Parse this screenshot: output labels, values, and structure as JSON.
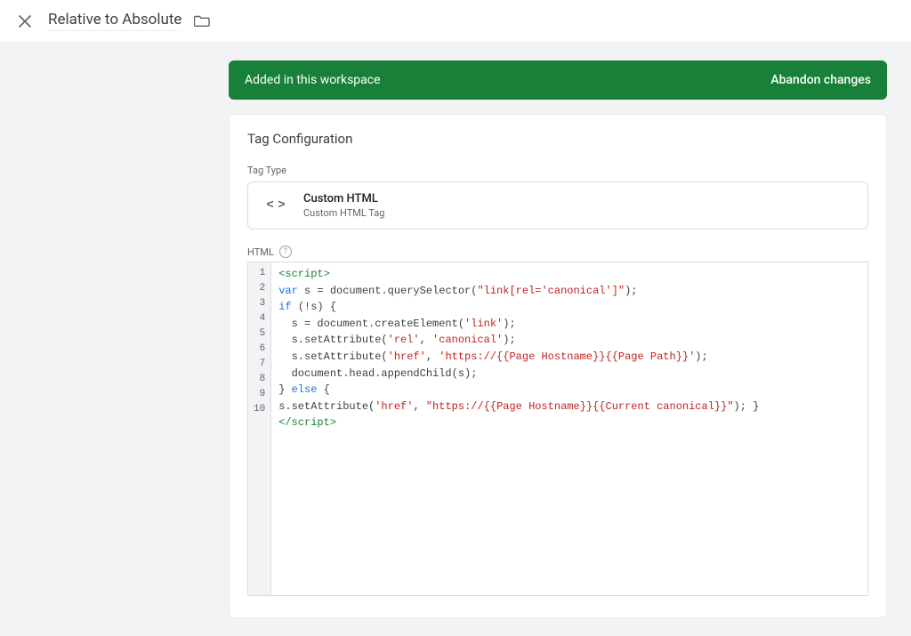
{
  "topbar": {
    "title": "Relative to Absolute"
  },
  "banner": {
    "message": "Added in this workspace",
    "action": "Abandon changes"
  },
  "card": {
    "title": "Tag Configuration",
    "tagtype_label": "Tag Type",
    "tagtype_name": "Custom HTML",
    "tagtype_sub": "Custom HTML Tag",
    "html_label": "HTML",
    "code_lines": [
      {
        "n": 1,
        "raw": "<script>",
        "tokens": [
          [
            "<script>",
            "tag"
          ]
        ]
      },
      {
        "n": 2,
        "raw": "var s = document.querySelector(\"link[rel='canonical']\");",
        "tokens": [
          [
            "var ",
            "kw"
          ],
          [
            "s = document.querySelector(",
            "def"
          ],
          [
            "\"link[rel='canonical']\"",
            "str"
          ],
          [
            ");",
            "def"
          ]
        ]
      },
      {
        "n": 3,
        "raw": "if (!s) {",
        "tokens": [
          [
            "if ",
            "kw"
          ],
          [
            "(!s) {",
            "def"
          ]
        ]
      },
      {
        "n": 4,
        "raw": "  s = document.createElement('link');",
        "tokens": [
          [
            "  s = document.createElement(",
            "def"
          ],
          [
            "'link'",
            "str"
          ],
          [
            ");",
            "def"
          ]
        ]
      },
      {
        "n": 5,
        "raw": "  s.setAttribute('rel', 'canonical');",
        "tokens": [
          [
            "  s.setAttribute(",
            "def"
          ],
          [
            "'rel'",
            "str"
          ],
          [
            ", ",
            "def"
          ],
          [
            "'canonical'",
            "str"
          ],
          [
            ");",
            "def"
          ]
        ]
      },
      {
        "n": 6,
        "raw": "  s.setAttribute('href', 'https://{{Page Hostname}}{{Page Path}}');",
        "tokens": [
          [
            "  s.setAttribute(",
            "def"
          ],
          [
            "'href'",
            "str"
          ],
          [
            ", ",
            "def"
          ],
          [
            "'https://{{Page Hostname}}{{Page Path}}'",
            "str"
          ],
          [
            ");",
            "def"
          ]
        ]
      },
      {
        "n": 7,
        "raw": "  document.head.appendChild(s);",
        "tokens": [
          [
            "  document.head.appendChild(s);",
            "def"
          ]
        ]
      },
      {
        "n": 8,
        "raw": "} else {",
        "tokens": [
          [
            "} ",
            "def"
          ],
          [
            "else ",
            "kw"
          ],
          [
            "{",
            "def"
          ]
        ]
      },
      {
        "n": 9,
        "raw": "s.setAttribute('href', \"https://{{Page Hostname}}{{Current canonical}}\"); }",
        "tokens": [
          [
            "s.setAttribute(",
            "def"
          ],
          [
            "'href'",
            "str"
          ],
          [
            ", ",
            "def"
          ],
          [
            "\"https://{{Page Hostname}}{{Current canonical}}\"",
            "str"
          ],
          [
            "); }",
            "def"
          ]
        ]
      },
      {
        "n": 10,
        "raw": "</script>",
        "tokens": [
          [
            "</script>",
            "tag"
          ]
        ]
      }
    ]
  }
}
